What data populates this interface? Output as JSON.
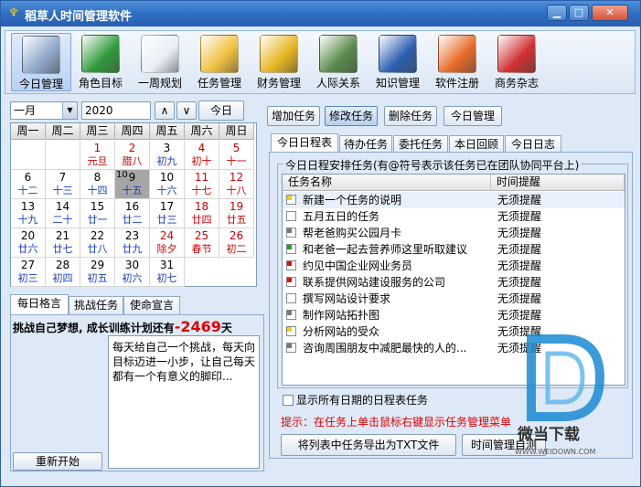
{
  "window": {
    "title": "稻草人时间管理软件"
  },
  "toolbar": [
    {
      "label": "今日管理",
      "icon": "calendar-icon",
      "color": "#8fa7c8"
    },
    {
      "label": "角色目标",
      "icon": "book-icon",
      "color": "#2f9a3a"
    },
    {
      "label": "一周规划",
      "icon": "cards-icon",
      "color": "#e8eef8"
    },
    {
      "label": "任务管理",
      "icon": "org-chart-icon",
      "color": "#f0c040"
    },
    {
      "label": "财务管理",
      "icon": "coins-icon",
      "color": "#e6b520"
    },
    {
      "label": "人际关系",
      "icon": "contact-card-icon",
      "color": "#5a8a4a"
    },
    {
      "label": "知识管理",
      "icon": "knowledge-book-icon",
      "color": "#2c5fb0"
    },
    {
      "label": "软件注册",
      "icon": "magic-wand-icon",
      "color": "#e86a2a"
    },
    {
      "label": "商务杂志",
      "icon": "scissors-icon",
      "color": "#d03030"
    }
  ],
  "calendar": {
    "month": "一月",
    "year": "2020",
    "up": "∧",
    "down": "∨",
    "today_button": "今日",
    "weekdays": [
      "周一",
      "周二",
      "周三",
      "周四",
      "周五",
      "周六",
      "周日"
    ],
    "cells": [
      {
        "d": "",
        "l": ""
      },
      {
        "d": "",
        "l": ""
      },
      {
        "d": "1",
        "l": "元旦",
        "red": true
      },
      {
        "d": "2",
        "l": "腊八",
        "red": true
      },
      {
        "d": "3",
        "l": "初九"
      },
      {
        "d": "4",
        "l": "初十",
        "red": true
      },
      {
        "d": "5",
        "l": "十一",
        "red": true
      },
      {
        "d": "6",
        "l": "十二"
      },
      {
        "d": "7",
        "l": "十三"
      },
      {
        "d": "8",
        "l": "十四"
      },
      {
        "d": "9",
        "l": "十五",
        "today": true,
        "tag": "10"
      },
      {
        "d": "10",
        "l": "十六"
      },
      {
        "d": "11",
        "l": "十七",
        "red": true
      },
      {
        "d": "12",
        "l": "十八",
        "red": true
      },
      {
        "d": "13",
        "l": "十九"
      },
      {
        "d": "14",
        "l": "二十"
      },
      {
        "d": "15",
        "l": "廿一"
      },
      {
        "d": "16",
        "l": "廿二"
      },
      {
        "d": "17",
        "l": "廿三"
      },
      {
        "d": "18",
        "l": "廿四",
        "red": true
      },
      {
        "d": "19",
        "l": "廿五",
        "red": true
      },
      {
        "d": "20",
        "l": "廿六"
      },
      {
        "d": "21",
        "l": "廿七"
      },
      {
        "d": "22",
        "l": "廿八"
      },
      {
        "d": "23",
        "l": "廿九"
      },
      {
        "d": "24",
        "l": "除夕",
        "red": true
      },
      {
        "d": "25",
        "l": "春节",
        "red": true
      },
      {
        "d": "26",
        "l": "初二",
        "red": true
      },
      {
        "d": "27",
        "l": "初三"
      },
      {
        "d": "28",
        "l": "初四"
      },
      {
        "d": "29",
        "l": "初五"
      },
      {
        "d": "30",
        "l": "初六"
      },
      {
        "d": "31",
        "l": "初七"
      }
    ]
  },
  "motto": {
    "tabs": [
      "每日格言",
      "挑战任务",
      "使命宣言"
    ],
    "challenge_prefix": "挑战自己梦想, 成长训练计划还有",
    "challenge_days": "-2469",
    "challenge_suffix": "天",
    "text": "每天给自己一个挑战，每天向目标迈进一小步，让自己每天都有一个有意义的脚印...",
    "reset_button": "重新开始"
  },
  "actions": {
    "add": "增加任务",
    "edit": "修改任务",
    "delete": "删除任务",
    "today": "今日管理"
  },
  "tabs": [
    "今日日程表",
    "待办任务",
    "委托任务",
    "本日回顾",
    "今日日志"
  ],
  "schedule": {
    "group_title": "今日日程安排任务(有@符号表示该任务已在团队协同平台上)",
    "col_name": "任务名称",
    "col_remind": "时间提醒",
    "rows": [
      {
        "name": "新建一个任务的说明",
        "remind": "无须提醒",
        "flag": "#f0d000"
      },
      {
        "name": "五月五日的任务",
        "remind": "无须提醒",
        "flag": ""
      },
      {
        "name": "帮老爸购买公园月卡",
        "remind": "无须提醒",
        "flag": "#777777"
      },
      {
        "name": "和老爸一起去营养师这里听取建议",
        "remind": "无须提醒",
        "flag": "#22a022"
      },
      {
        "name": "约见中国企业网业务员",
        "remind": "无须提醒",
        "flag": "#e01010"
      },
      {
        "name": "联系提供网站建设服务的公司",
        "remind": "无须提醒",
        "flag": "#e01010"
      },
      {
        "name": "撰写网站设计要求",
        "remind": "无须提醒",
        "flag": ""
      },
      {
        "name": "制作网站拓扑图",
        "remind": "无须提醒",
        "flag": "#777777"
      },
      {
        "name": "分析网站的受众",
        "remind": "无须提醒",
        "flag": "#f0d000"
      },
      {
        "name": "咨询周围朋友中减肥最快的人的...",
        "remind": "无须提醒",
        "flag": "#777777"
      }
    ],
    "show_all_label": "显示所有日期的日程表任务",
    "hint": "提示：在任务上单击鼠标右键显示任务管理菜单",
    "export_button": "将列表中任务导出为TXT文件",
    "help_button": "时间管理自测"
  },
  "watermark": {
    "brand": "微当下载",
    "url": "WWW.WEIDOWN.COM"
  }
}
